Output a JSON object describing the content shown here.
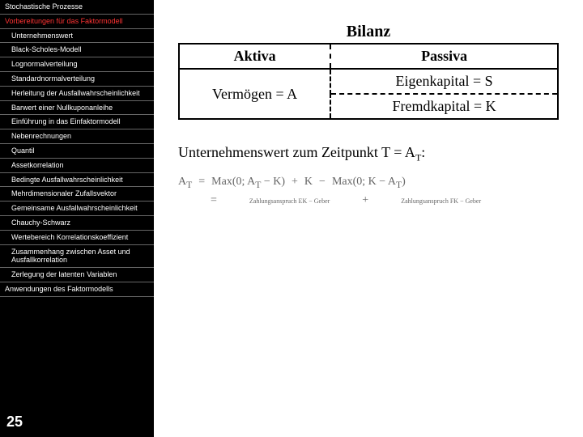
{
  "nav": {
    "items": [
      {
        "label": "Stochastische Prozesse",
        "cls": "top"
      },
      {
        "label": "Vorbereitungen für das Faktormodell",
        "cls": "section"
      },
      {
        "label": "Unternehmenswert",
        "cls": "sub"
      },
      {
        "label": "Black-Scholes-Modell",
        "cls": "sub"
      },
      {
        "label": "Lognormalverteilung",
        "cls": "sub"
      },
      {
        "label": "Standardnormalverteilung",
        "cls": "sub"
      },
      {
        "label": "Herleitung der Ausfallwahrscheinlichkeit",
        "cls": "sub"
      },
      {
        "label": "Barwert einer Nullkuponanleihe",
        "cls": "sub"
      },
      {
        "label": "Einführung in das Einfaktormodell",
        "cls": "sub"
      },
      {
        "label": "Nebenrechnungen",
        "cls": "sub"
      },
      {
        "label": "Quantil",
        "cls": "sub"
      },
      {
        "label": "Assetkorrelation",
        "cls": "sub"
      },
      {
        "label": "Bedingte Ausfallwahrscheinlichkeit",
        "cls": "sub"
      },
      {
        "label": "Mehrdimensionaler Zufallsvektor",
        "cls": "sub"
      },
      {
        "label": "Gemeinsame Ausfallwahrscheinlichkeit",
        "cls": "sub"
      },
      {
        "label": "Chauchy-Schwarz",
        "cls": "sub"
      },
      {
        "label": "Wertebereich Korrelationskoeffizient",
        "cls": "sub"
      },
      {
        "label": "Zusammenhang zwischen Asset und Ausfallkorrelation",
        "cls": "sub"
      },
      {
        "label": "Zerlegung der latenten Variablen",
        "cls": "sub"
      },
      {
        "label": "Anwendungen des Faktormodells",
        "cls": "top"
      }
    ]
  },
  "pageNumber": "25",
  "table": {
    "title": "Bilanz",
    "headers": {
      "aktiva": "Aktiva",
      "passiva": "Passiva"
    },
    "aktiva": "Vermögen = A",
    "passiva1": "Eigenkapital = S",
    "passiva2": "Fremdkapital = K"
  },
  "statement": {
    "prefix": "Unternehmenswert zum Zeitpunkt T = A",
    "sub": "T",
    "suffix": ":"
  },
  "formula": {
    "lhs": "A",
    "lhsSub": "T",
    "eq": "=",
    "max1": "Max(0; A",
    "max1sub": "T",
    "max1end": " − K)",
    "plus": "+",
    "k": "K",
    "minus": "−",
    "max2": "Max(0; K − A",
    "max2sub": "T",
    "max2end": ")",
    "row2": {
      "t1": "Zahlungsanspruch EK − Geber",
      "t2": "Zahlungsanspruch FK − Geber"
    }
  }
}
